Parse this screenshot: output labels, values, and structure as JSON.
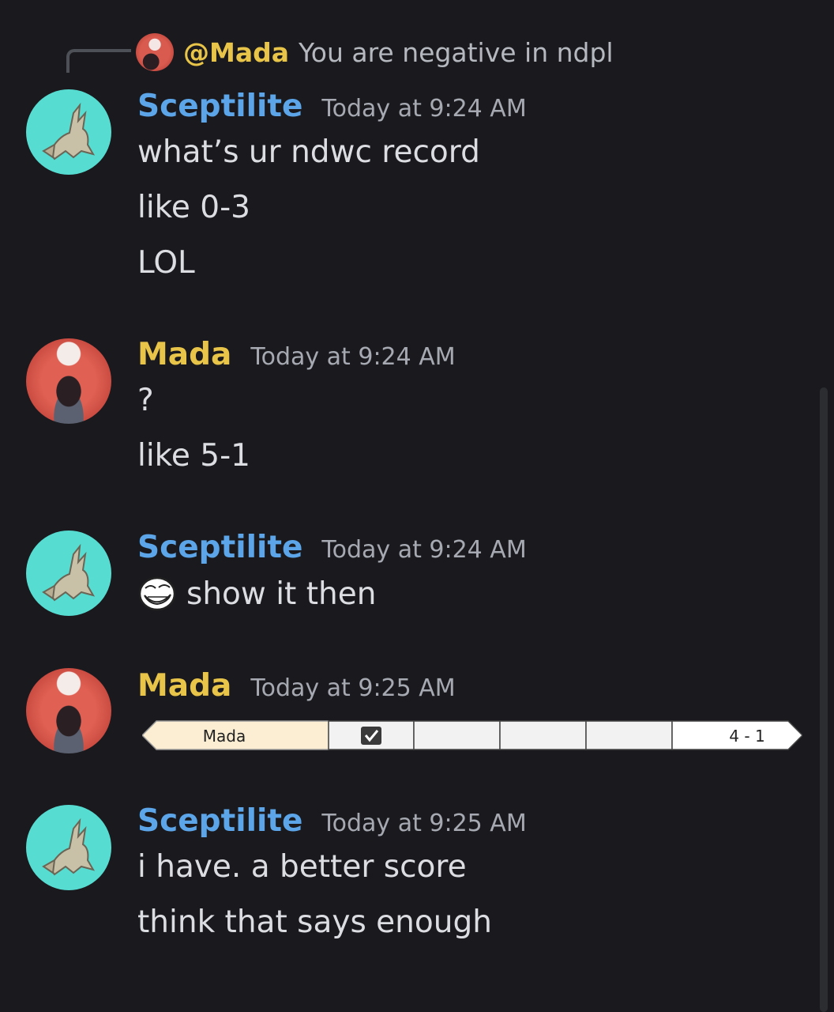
{
  "reply": {
    "mention": "@Mada",
    "text": "You are negative in ndpl"
  },
  "messages": [
    {
      "username": "Sceptilite",
      "timestamp": "Today at 9:24 AM",
      "lines": [
        "what’s ur ndwc record",
        "like 0-3",
        "LOL"
      ]
    },
    {
      "username": "Mada",
      "timestamp": "Today at 9:24 AM",
      "lines": [
        "?",
        "like 5-1"
      ]
    },
    {
      "username": "Sceptilite",
      "timestamp": "Today at 9:24 AM",
      "lines": [
        "show it then"
      ],
      "emoji": "trollface-emoji"
    },
    {
      "username": "Mada",
      "timestamp": "Today at 9:25 AM",
      "attachment": {
        "name": "Mada",
        "score": "4 - 1",
        "slots": [
          "checked",
          "empty",
          "empty",
          "empty",
          "empty"
        ]
      }
    },
    {
      "username": "Sceptilite",
      "timestamp": "Today at 9:25 AM",
      "lines": [
        "i have. a better score",
        "think that says enough"
      ]
    }
  ],
  "colors": {
    "background": "#1a1a1e",
    "sceptilite_name": "#5ba5e8",
    "mada_name": "#e8c449",
    "timestamp": "#a6a9b1"
  }
}
